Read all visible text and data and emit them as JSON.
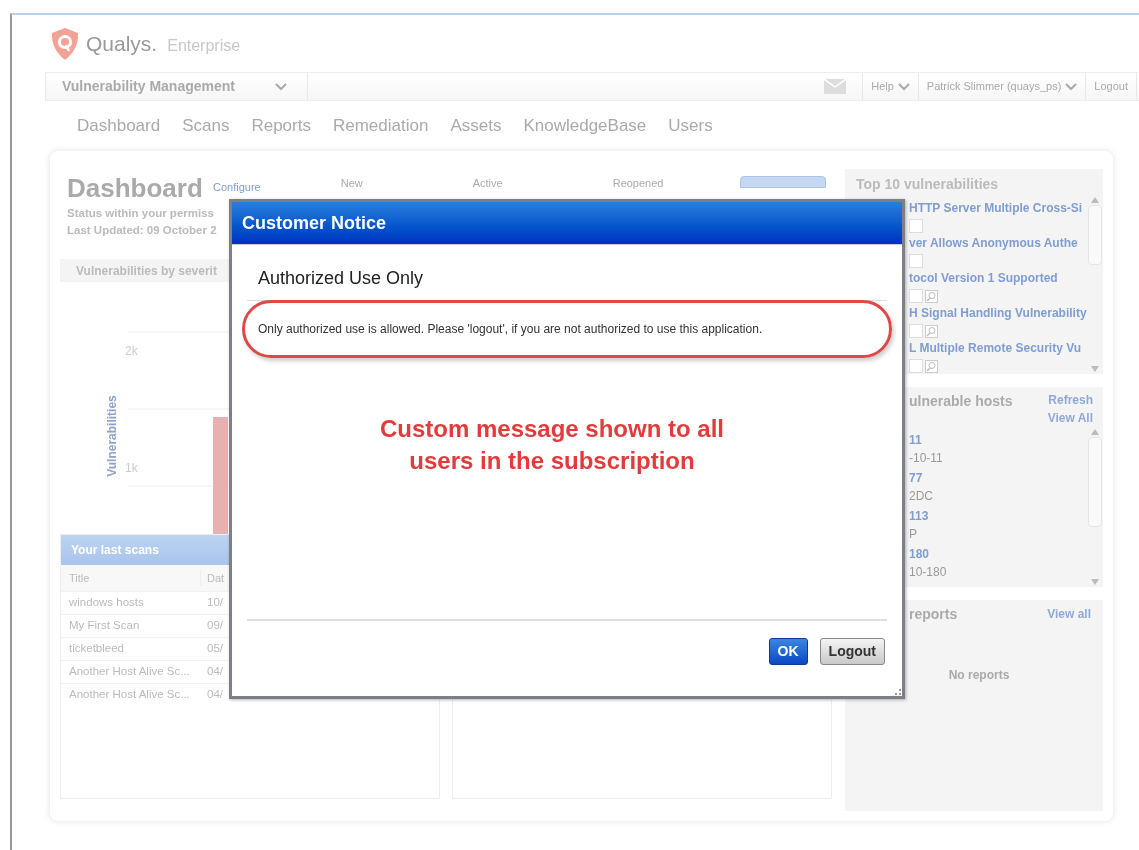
{
  "header": {
    "brand": "Qualys.",
    "edition": "Enterprise"
  },
  "module_bar": {
    "module": "Vulnerability Management",
    "help": "Help",
    "user": "Patrick Slimmer (quays_ps)",
    "logout": "Logout"
  },
  "nav": [
    {
      "label": "Dashboard",
      "selected": false
    },
    {
      "label": "Scans",
      "selected": false
    },
    {
      "label": "Reports",
      "selected": false
    },
    {
      "label": "Remediation",
      "selected": false
    },
    {
      "label": "Assets",
      "selected": false
    },
    {
      "label": "KnowledgeBase",
      "selected": false
    },
    {
      "label": "Users",
      "selected": false
    }
  ],
  "dashboard": {
    "title": "Dashboard",
    "configure": "Configure",
    "subtitle": "Status within your permiss",
    "updated": "Last Updated: 09 October 2",
    "columns": [
      "New",
      "Active",
      "Reopened"
    ]
  },
  "severity_chart": {
    "title": "Vulnerabilities by severit",
    "ylabel": "Vulnerabilities",
    "tick_labels": [
      "2k",
      "1k"
    ]
  },
  "last_scans": {
    "title": "Your last scans",
    "columns": [
      "Title",
      "Dat"
    ],
    "rows": [
      [
        "windows hosts",
        "10/"
      ],
      [
        "My First Scan",
        "09/"
      ],
      [
        "ticketbleed",
        "05/"
      ],
      [
        "Another Host Alive Sc...",
        "04/"
      ],
      [
        "Another Host Alive Sc...",
        "04/"
      ]
    ]
  },
  "top_vulnerabilities": {
    "title": "Top 10 vulnerabilities",
    "items": [
      {
        "name": "HTTP Server Multiple Cross-Si",
        "kind": "plain"
      },
      {
        "name": "ver Allows Anonymous Authe",
        "kind": "plain"
      },
      {
        "name": "tocol Version 1 Supported",
        "kind": "detail"
      },
      {
        "name": "H Signal Handling Vulnerability",
        "kind": "detail"
      },
      {
        "name": "L Multiple Remote Security Vu",
        "kind": "detail"
      }
    ]
  },
  "vulnerable_hosts": {
    "title": "ulnerable hosts",
    "refresh": "Refresh",
    "view_all": "View All",
    "hosts": [
      {
        "id": "11",
        "name": "-10-11"
      },
      {
        "id": "77",
        "name": "2DC"
      },
      {
        "id": "113",
        "name": "P"
      },
      {
        "id": "180",
        "name": "10-180"
      }
    ]
  },
  "reports": {
    "title": "reports",
    "view_all": "View all",
    "empty": "No reports"
  },
  "dialog": {
    "title": "Customer Notice",
    "heading": "Authorized Use Only",
    "message": "Only authorized use is allowed. Please 'logout', if you are not authorized to use this application.",
    "annotation": "Custom message shown to all users in the subscription",
    "buttons": [
      {
        "label": "OK",
        "kind": "primary"
      },
      {
        "label": "Logout",
        "kind": "secondary"
      }
    ]
  }
}
